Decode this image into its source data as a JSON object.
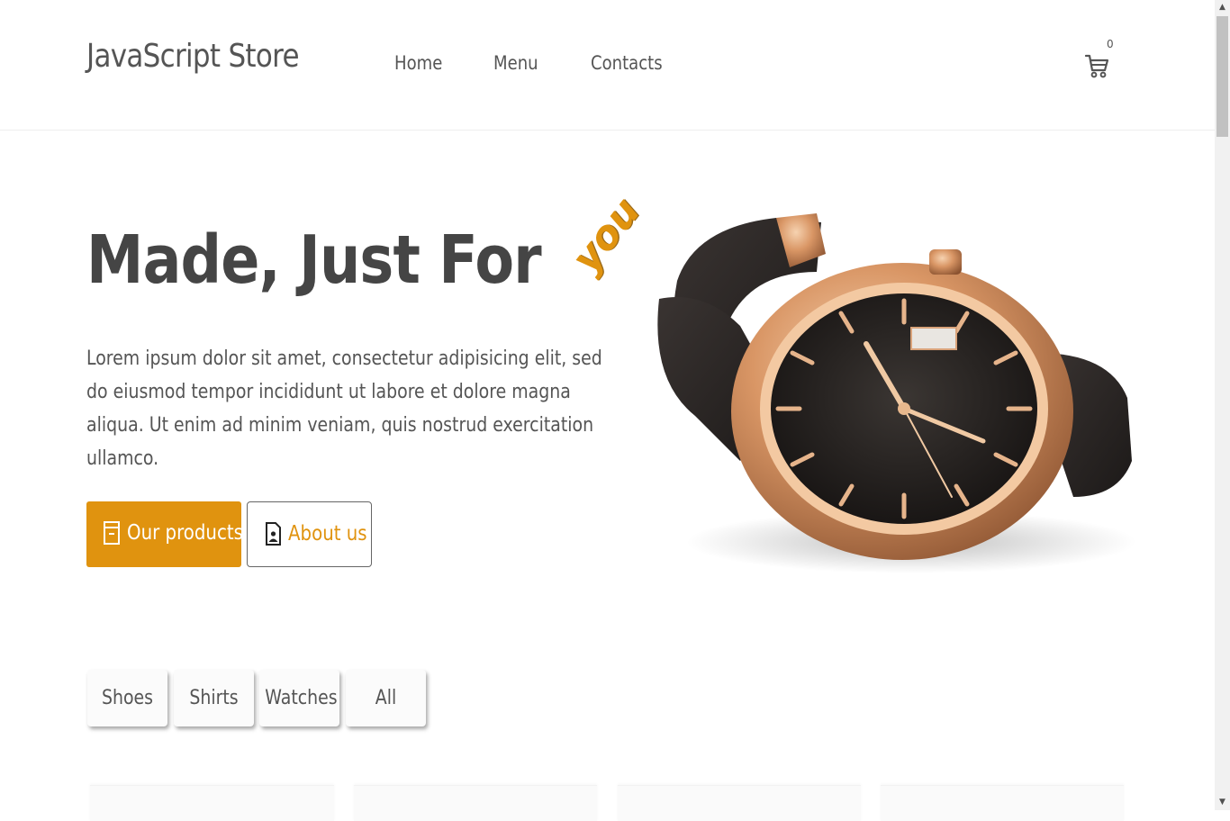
{
  "header": {
    "logo": "JavaScript Store",
    "nav": {
      "home": "Home",
      "menu": "Menu",
      "contacts": "Contacts"
    },
    "cart": {
      "icon": "cart-icon",
      "count": "0"
    }
  },
  "hero": {
    "title": "Made, Just For",
    "accent": "you",
    "description": "Lorem ipsum dolor sit amet, consectetur adipisicing elit, sed do eiusmod tempor incididunt ut labore et dolore magna aliqua. Ut enim ad minim veniam, quis nostrud exercitation ullamco.",
    "buttons": {
      "primary": {
        "label": "Our products",
        "icon": "box-icon"
      },
      "secondary": {
        "label": "About us",
        "icon": "document-person-icon"
      }
    },
    "image": "wristwatch-image"
  },
  "filters": [
    "Shoes",
    "Shirts",
    "Watches",
    "All"
  ],
  "colors": {
    "accent": "#e0930f",
    "text": "#4a4a4a",
    "background": "#ffffff"
  }
}
